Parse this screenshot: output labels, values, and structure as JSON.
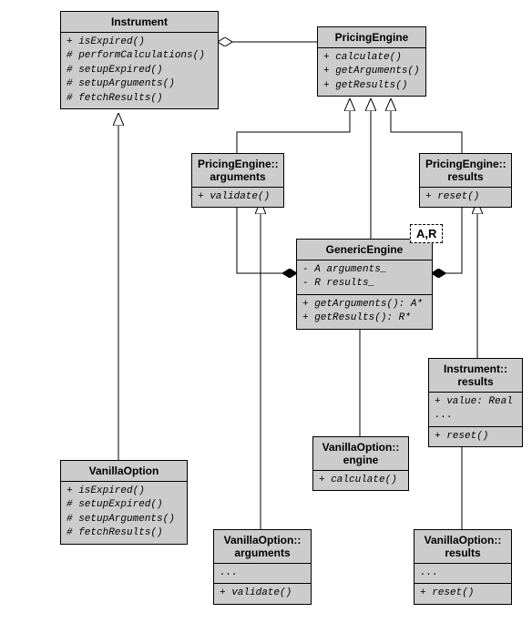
{
  "instrument": {
    "title": "Instrument",
    "m0": "+ isExpired()",
    "m1": "# performCalculations()",
    "m2": "# setupExpired()",
    "m3": "# setupArguments()",
    "m4": "# fetchResults()"
  },
  "pricingEngine": {
    "title": "PricingEngine",
    "m0": "+ calculate()",
    "m1": "+ getArguments()",
    "m2": "+ getResults()"
  },
  "peArguments": {
    "title": "PricingEngine::\narguments",
    "m0": "+ validate()"
  },
  "peResults": {
    "title": "PricingEngine::\nresults",
    "m0": "+ reset()"
  },
  "genericEngine": {
    "title": "GenericEngine",
    "templParam": "A,R",
    "a0": "- A arguments_",
    "a1": "- R results_",
    "m0": "+ getArguments(): A*",
    "m1": "+ getResults(): R*"
  },
  "instResults": {
    "title": "Instrument::\nresults",
    "a0": "+ value: Real",
    "a1": "...",
    "m0": "+ reset()"
  },
  "vanillaOption": {
    "title": "VanillaOption",
    "m0": "+ isExpired()",
    "m1": "# setupExpired()",
    "m2": "# setupArguments()",
    "m3": "# fetchResults()"
  },
  "voEngine": {
    "title": "VanillaOption::\nengine",
    "m0": "+ calculate()"
  },
  "voArguments": {
    "title": "VanillaOption::\narguments",
    "a0": "...",
    "m0": "+ validate()"
  },
  "voResults": {
    "title": "VanillaOption::\nresults",
    "a0": "...",
    "m0": "+ reset()"
  }
}
